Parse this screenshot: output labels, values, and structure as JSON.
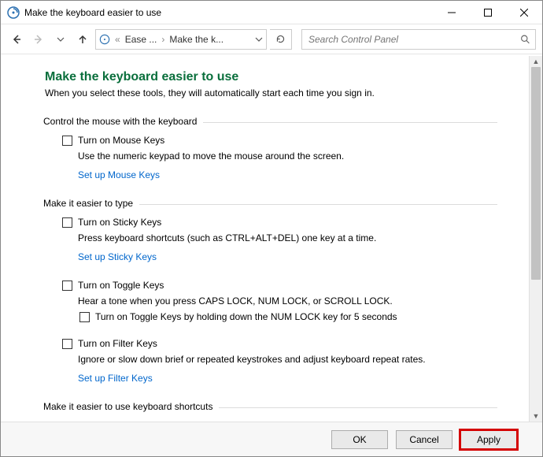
{
  "window": {
    "title": "Make the keyboard easier to use"
  },
  "nav": {
    "crumb1": "Ease ...",
    "crumb2": "Make the k...",
    "search_placeholder": "Search Control Panel"
  },
  "page": {
    "title": "Make the keyboard easier to use",
    "subtitle": "When you select these tools, they will automatically start each time you sign in."
  },
  "group_mouse": {
    "label": "Control the mouse with the keyboard",
    "opt1": "Turn on Mouse Keys",
    "desc1": "Use the numeric keypad to move the mouse around the screen.",
    "link1": "Set up Mouse Keys"
  },
  "group_type": {
    "label": "Make it easier to type",
    "sticky_opt": "Turn on Sticky Keys",
    "sticky_desc": "Press keyboard shortcuts (such as CTRL+ALT+DEL) one key at a time.",
    "sticky_link": "Set up Sticky Keys",
    "toggle_opt": "Turn on Toggle Keys",
    "toggle_desc": "Hear a tone when you press CAPS LOCK, NUM LOCK, or SCROLL LOCK.",
    "toggle_sub_opt": "Turn on Toggle Keys by holding down the NUM LOCK key for 5 seconds",
    "filter_opt": "Turn on Filter Keys",
    "filter_desc": "Ignore or slow down brief or repeated keystrokes and adjust keyboard repeat rates.",
    "filter_link": "Set up Filter Keys"
  },
  "group_cutoff": {
    "label": "Make it easier to use keyboard shortcuts"
  },
  "footer": {
    "ok": "OK",
    "cancel": "Cancel",
    "apply": "Apply"
  }
}
